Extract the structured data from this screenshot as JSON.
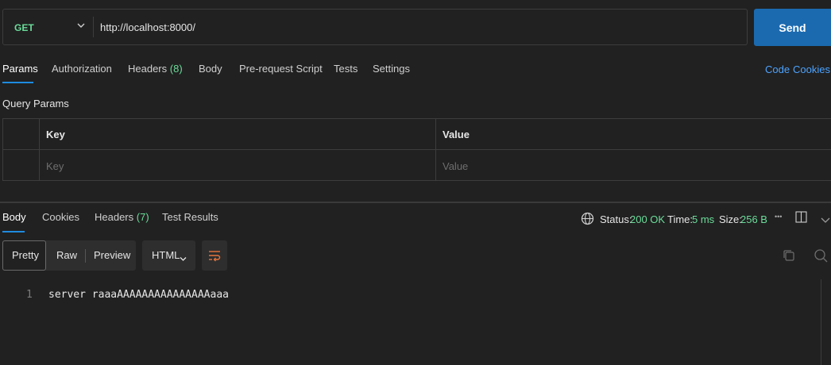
{
  "request": {
    "method": "GET",
    "url": "http://localhost:8000/",
    "send_label": "Send"
  },
  "request_tabs": [
    {
      "label": "Params",
      "active": true
    },
    {
      "label": "Authorization"
    },
    {
      "label": "Headers",
      "count": "(8)"
    },
    {
      "label": "Body"
    },
    {
      "label": "Pre-request Script"
    },
    {
      "label": "Tests"
    },
    {
      "label": "Settings"
    }
  ],
  "links": {
    "code": "Code",
    "cookies": "Cookies"
  },
  "query_params": {
    "title": "Query Params",
    "columns": [
      "Key",
      "Value"
    ],
    "placeholders": {
      "key": "Key",
      "value": "Value"
    }
  },
  "response_tabs": [
    {
      "label": "Body",
      "active": true
    },
    {
      "label": "Cookies"
    },
    {
      "label": "Headers",
      "count": "(7)"
    },
    {
      "label": "Test Results"
    }
  ],
  "status": {
    "status_label": "Status:",
    "status_value": "200 OK",
    "time_label": "Time:",
    "time_value": "5 ms",
    "size_label": "Size:",
    "size_value": "256 B",
    "more": "•••"
  },
  "view": {
    "modes": [
      "Pretty",
      "Raw",
      "Preview"
    ],
    "format": "HTML"
  },
  "body_lines": [
    {
      "num": "1",
      "text": "server raaaAAAAAAAAAAAAAAAaaa"
    }
  ],
  "colors": {
    "accent": "#1f8be0",
    "send": "#1b6ab0",
    "success": "#6bdd9a",
    "link": "#4da3ff"
  }
}
